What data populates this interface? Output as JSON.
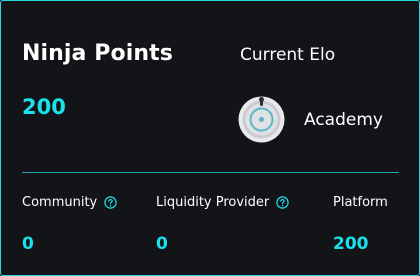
{
  "ninja_points": {
    "title": "Ninja Points",
    "value": "200"
  },
  "elo": {
    "label": "Current Elo",
    "rank_name": "Academy",
    "badge_icon": "academy-badge-icon"
  },
  "breakdown": [
    {
      "label": "Community",
      "value": "0",
      "has_help": true
    },
    {
      "label": "Liquidity Provider",
      "value": "0",
      "has_help": true
    },
    {
      "label": "Platform",
      "value": "200",
      "has_help": false
    }
  ],
  "colors": {
    "accent": "#19e2ec",
    "border": "#28d7e2",
    "background": "#121418",
    "text": "#ffffff"
  }
}
